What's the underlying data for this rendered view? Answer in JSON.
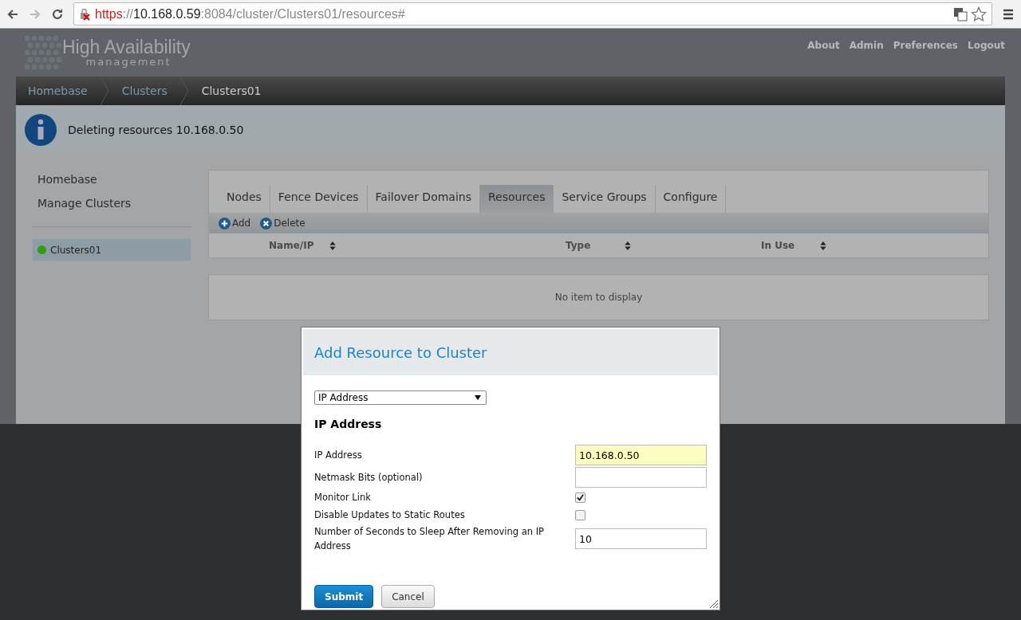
{
  "browser": {
    "url": {
      "scheme": "https",
      "separator": "://",
      "host": "10.168.0.59",
      "path": ":8084/cluster/Clusters01/resources#"
    }
  },
  "header": {
    "logo_title": "High Availability",
    "logo_subtitle": "management",
    "links": [
      "About",
      "Admin",
      "Preferences",
      "Logout"
    ]
  },
  "breadcrumb": [
    "Homebase",
    "Clusters",
    "Clusters01"
  ],
  "notice": {
    "message": "Deleting resources 10.168.0.50"
  },
  "sidebar": {
    "items": [
      "Homebase",
      "Manage Clusters"
    ],
    "clusters": [
      {
        "label": "Clusters01",
        "selected": true,
        "color": "#2f9e12"
      }
    ]
  },
  "tabs": [
    {
      "label": "Nodes",
      "selected": false
    },
    {
      "label": "Fence Devices",
      "selected": false
    },
    {
      "label": "Failover Domains",
      "selected": false
    },
    {
      "label": "Resources",
      "selected": true
    },
    {
      "label": "Service Groups",
      "selected": false
    },
    {
      "label": "Configure",
      "selected": false
    }
  ],
  "toolbar": [
    {
      "label": "Add",
      "kind": "add"
    },
    {
      "label": "Delete",
      "kind": "delete"
    }
  ],
  "table": {
    "columns": [
      "Name/IP",
      "Type",
      "In Use"
    ],
    "empty_text": "No item to display"
  },
  "dialog": {
    "title": "Add Resource to Cluster",
    "resource_type": "IP Address",
    "section": "IP Address",
    "fields": [
      {
        "kind": "text",
        "label": "IP Address",
        "value": "10.168.0.50",
        "highlighted": true
      },
      {
        "kind": "text",
        "label": "Netmask Bits (optional)",
        "highlighted": false
      },
      {
        "kind": "checkbox",
        "label": "Monitor Link",
        "checked": true
      },
      {
        "kind": "checkbox",
        "label": "Disable Updates to Static Routes",
        "checked": false
      },
      {
        "kind": "text",
        "label": "Number of Seconds to Sleep After Removing an IP Address",
        "value": "10",
        "highlighted": false
      }
    ],
    "buttons": [
      {
        "label": "Submit",
        "kind": "primary"
      },
      {
        "label": "Cancel",
        "kind": "secondary"
      }
    ]
  }
}
